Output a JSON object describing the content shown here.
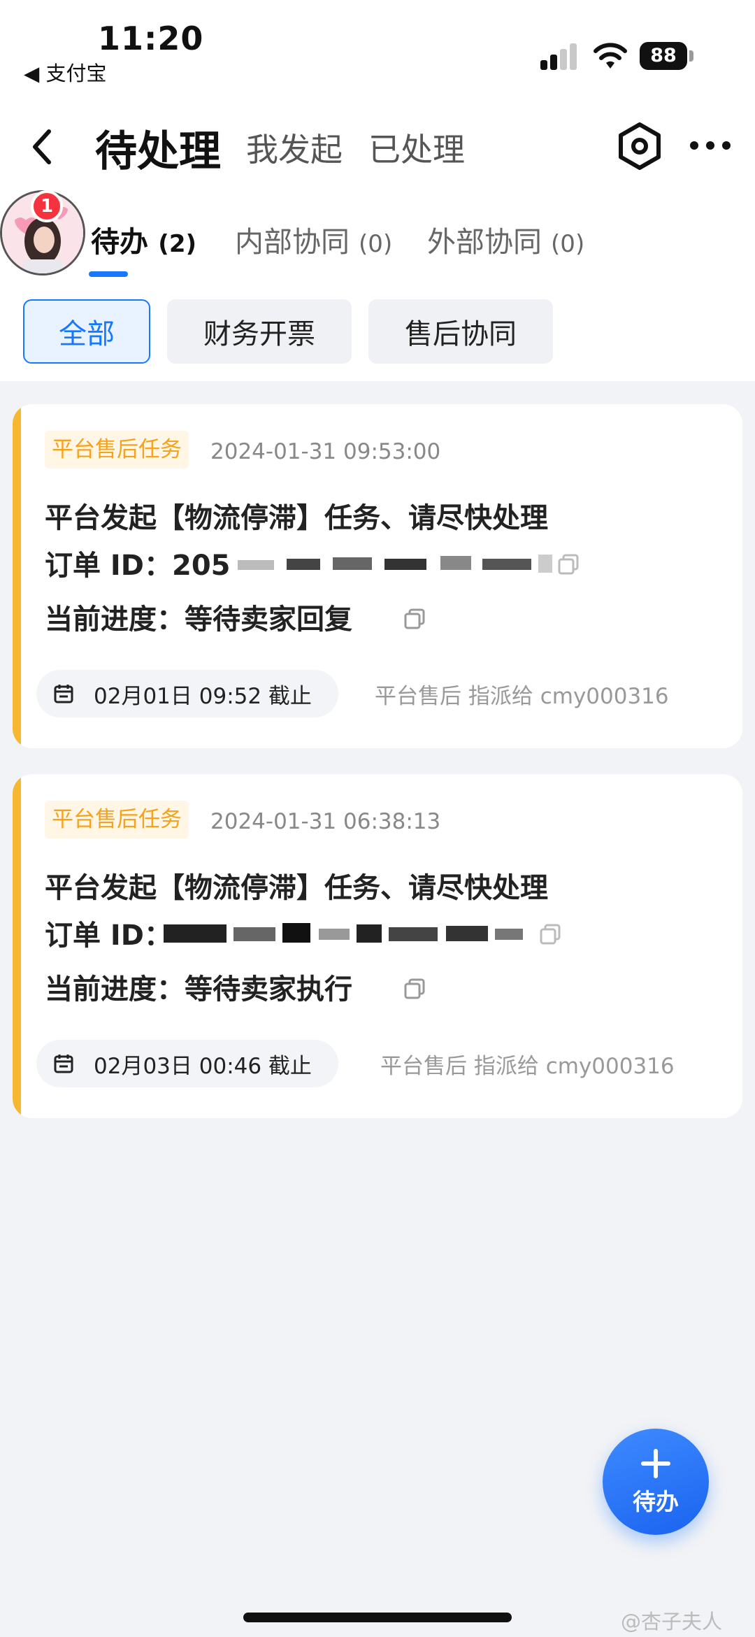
{
  "status_bar": {
    "time": "11:20",
    "back_app": "◀ 支付宝",
    "battery": "88"
  },
  "header": {
    "active_title": "待处理",
    "tabs": [
      {
        "label": "我发起"
      },
      {
        "label": "已处理"
      }
    ]
  },
  "avatar": {
    "badge": "1"
  },
  "subtabs": [
    {
      "label": "待办",
      "count": "(2)"
    },
    {
      "label": "内部协同",
      "count": "(0)"
    },
    {
      "label": "外部协同",
      "count": "(0)"
    }
  ],
  "filters": [
    {
      "label": "全部"
    },
    {
      "label": "财务开票"
    },
    {
      "label": "售后协同"
    }
  ],
  "cards": [
    {
      "tag": "平台售后任务",
      "time": "2024-01-31 09:53:00",
      "title": "平台发起【物流停滞】任务、请尽快处理",
      "order_label": "订单 ID：",
      "order_visible": "205",
      "progress": "当前进度：等待卖家回复",
      "deadline": "02月01日 09:52 截止",
      "assign": "平台售后 指派给 cmy000316"
    },
    {
      "tag": "平台售后任务",
      "time": "2024-01-31 06:38:13",
      "title": "平台发起【物流停滞】任务、请尽快处理",
      "order_label": "订单 ID：",
      "order_visible": "",
      "progress": "当前进度：等待卖家执行",
      "deadline": "02月03日 00:46 截止",
      "assign": "平台售后 指派给 cmy000316"
    }
  ],
  "fab": {
    "label": "待办"
  },
  "watermark": "@杏子夫人",
  "colors": {
    "accent": "#1677ff",
    "card_accent": "#f7b731",
    "tag_text": "#f7a21b",
    "badge": "#f5333f"
  }
}
